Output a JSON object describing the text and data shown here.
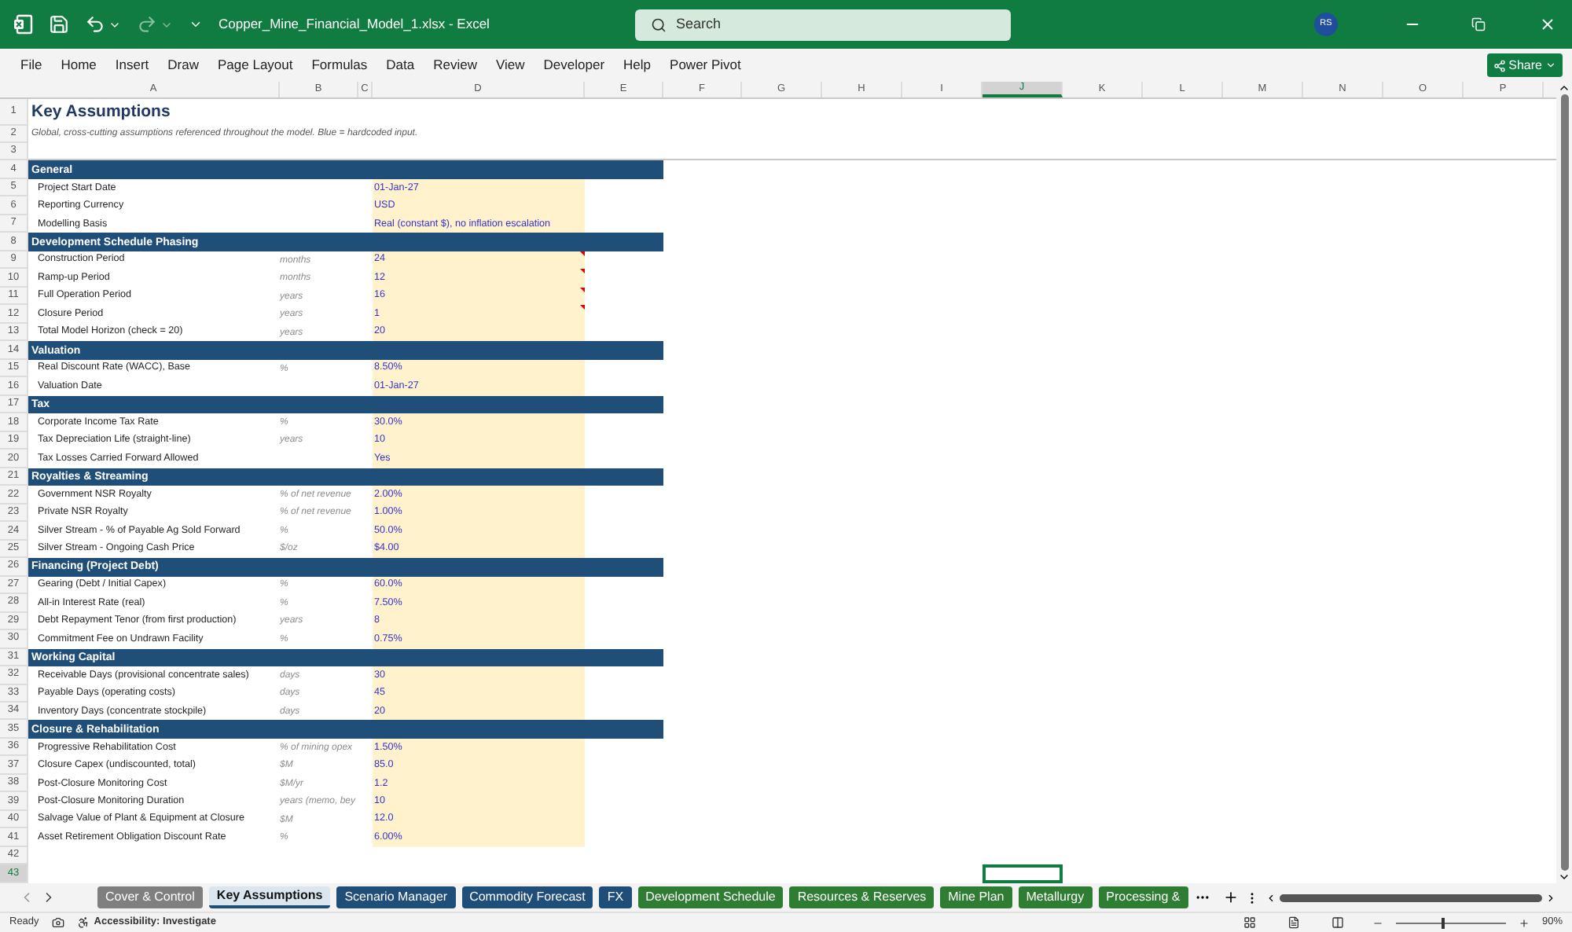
{
  "window": {
    "title": "Copper_Mine_Financial_Model_1.xlsx  -  Excel",
    "search_placeholder": "Search",
    "user_initials": "RS"
  },
  "menu": {
    "items": [
      "File",
      "Home",
      "Insert",
      "Draw",
      "Page Layout",
      "Formulas",
      "Data",
      "Review",
      "View",
      "Developer",
      "Help",
      "Power Pivot"
    ],
    "share": "Share"
  },
  "columns": [
    {
      "label": "A",
      "selected": false
    },
    {
      "label": "B",
      "selected": false
    },
    {
      "label": "C",
      "selected": false
    },
    {
      "label": "D",
      "selected": false
    },
    {
      "label": "E",
      "selected": false
    },
    {
      "label": "F",
      "selected": false
    },
    {
      "label": "G",
      "selected": false
    },
    {
      "label": "H",
      "selected": false
    },
    {
      "label": "I",
      "selected": false
    },
    {
      "label": "J",
      "selected": true
    },
    {
      "label": "K",
      "selected": false
    },
    {
      "label": "L",
      "selected": false
    },
    {
      "label": "M",
      "selected": false
    },
    {
      "label": "N",
      "selected": false
    },
    {
      "label": "O",
      "selected": false
    },
    {
      "label": "P",
      "selected": false
    }
  ],
  "rows": [
    {
      "number": "1",
      "kind": "title",
      "label": "Key Assumptions",
      "selected": false
    },
    {
      "number": "2",
      "kind": "note",
      "label": "Global, cross-cutting assumptions referenced throughout the model. Blue = hardcoded input.",
      "selected": false
    },
    {
      "number": "3",
      "kind": "blank",
      "selected": false
    },
    {
      "number": "4",
      "kind": "section",
      "label": "General",
      "selected": false
    },
    {
      "number": "5",
      "kind": "item",
      "label": "Project Start Date",
      "value": "01-Jan-27",
      "selected": false
    },
    {
      "number": "6",
      "kind": "item",
      "label": "Reporting Currency",
      "value": "USD",
      "selected": false
    },
    {
      "number": "7",
      "kind": "item",
      "label": "Modelling Basis",
      "value": "Real (constant $), no inflation escalation",
      "selected": false
    },
    {
      "number": "8",
      "kind": "section",
      "label": "Development Schedule Phasing",
      "selected": false
    },
    {
      "number": "9",
      "kind": "item",
      "label": "Construction Period",
      "unit": "months",
      "value": "24",
      "comment": true,
      "selected": false
    },
    {
      "number": "10",
      "kind": "item",
      "label": "Ramp-up Period",
      "unit": "months",
      "value": "12",
      "comment": true,
      "selected": false
    },
    {
      "number": "11",
      "kind": "item",
      "label": "Full Operation Period",
      "unit": "years",
      "value": "16",
      "comment": true,
      "selected": false
    },
    {
      "number": "12",
      "kind": "item",
      "label": "Closure Period",
      "unit": "years",
      "value": "1",
      "comment": true,
      "selected": false
    },
    {
      "number": "13",
      "kind": "item",
      "label": "Total Model Horizon (check = 20)",
      "unit": "years",
      "value": "20",
      "selected": false
    },
    {
      "number": "14",
      "kind": "section",
      "label": "Valuation",
      "selected": false
    },
    {
      "number": "15",
      "kind": "item",
      "label": "Real Discount Rate (WACC), Base",
      "unit": "%",
      "value": "8.50%",
      "selected": false
    },
    {
      "number": "16",
      "kind": "item",
      "label": "Valuation Date",
      "value": "01-Jan-27",
      "selected": false
    },
    {
      "number": "17",
      "kind": "section",
      "label": "Tax",
      "selected": false
    },
    {
      "number": "18",
      "kind": "item",
      "label": "Corporate Income Tax Rate",
      "unit": "%",
      "value": "30.0%",
      "selected": false
    },
    {
      "number": "19",
      "kind": "item",
      "label": "Tax Depreciation Life (straight-line)",
      "unit": "years",
      "value": "10",
      "selected": false
    },
    {
      "number": "20",
      "kind": "item",
      "label": "Tax Losses Carried Forward Allowed",
      "value": "Yes",
      "selected": false
    },
    {
      "number": "21",
      "kind": "section",
      "label": "Royalties & Streaming",
      "selected": false
    },
    {
      "number": "22",
      "kind": "item",
      "label": "Government NSR Royalty",
      "unit": "% of net revenue",
      "value": "2.00%",
      "selected": false
    },
    {
      "number": "23",
      "kind": "item",
      "label": "Private NSR Royalty",
      "unit": "% of net revenue",
      "value": "1.00%",
      "selected": false
    },
    {
      "number": "24",
      "kind": "item",
      "label": "Silver Stream - % of Payable Ag Sold Forward",
      "unit": "%",
      "value": "50.0%",
      "selected": false
    },
    {
      "number": "25",
      "kind": "item",
      "label": "Silver Stream - Ongoing Cash Price",
      "unit": "$/oz",
      "value": "$4.00",
      "selected": false
    },
    {
      "number": "26",
      "kind": "section",
      "label": "Financing (Project Debt)",
      "selected": false
    },
    {
      "number": "27",
      "kind": "item",
      "label": "Gearing (Debt / Initial Capex)",
      "unit": "%",
      "value": "60.0%",
      "selected": false
    },
    {
      "number": "28",
      "kind": "item",
      "label": "All-in Interest Rate (real)",
      "unit": "%",
      "value": "7.50%",
      "selected": false
    },
    {
      "number": "29",
      "kind": "item",
      "label": "Debt Repayment Tenor (from first production)",
      "unit": "years",
      "value": "8",
      "selected": false
    },
    {
      "number": "30",
      "kind": "item",
      "label": "Commitment Fee on Undrawn Facility",
      "unit": "%",
      "value": "0.75%",
      "selected": false
    },
    {
      "number": "31",
      "kind": "section",
      "label": "Working Capital",
      "selected": false
    },
    {
      "number": "32",
      "kind": "item",
      "label": "Receivable Days (provisional concentrate sales)",
      "unit": "days",
      "value": "30",
      "selected": false
    },
    {
      "number": "33",
      "kind": "item",
      "label": "Payable Days (operating costs)",
      "unit": "days",
      "value": "45",
      "selected": false
    },
    {
      "number": "34",
      "kind": "item",
      "label": "Inventory Days (concentrate stockpile)",
      "unit": "days",
      "value": "20",
      "selected": false
    },
    {
      "number": "35",
      "kind": "section",
      "label": "Closure & Rehabilitation",
      "selected": false
    },
    {
      "number": "36",
      "kind": "item",
      "label": "Progressive Rehabilitation Cost",
      "unit": "% of mining opex",
      "value": "1.50%",
      "selected": false
    },
    {
      "number": "37",
      "kind": "item",
      "label": "Closure Capex (undiscounted, total)",
      "unit": "$M",
      "value": "85.0",
      "selected": false
    },
    {
      "number": "38",
      "kind": "item",
      "label": "Post-Closure Monitoring Cost",
      "unit": "$M/yr",
      "value": "1.2",
      "selected": false
    },
    {
      "number": "39",
      "kind": "item",
      "label": "Post-Closure Monitoring Duration",
      "unit": "years (memo, bey",
      "value": "10",
      "selected": false
    },
    {
      "number": "40",
      "kind": "item",
      "label": "Salvage Value of Plant & Equipment at Closure",
      "unit": "$M",
      "value": "12.0",
      "selected": false
    },
    {
      "number": "41",
      "kind": "item",
      "label": "Asset Retirement Obligation Discount Rate",
      "unit": "%",
      "value": "6.00%",
      "selected": false
    },
    {
      "number": "42",
      "kind": "blank",
      "selected": false
    },
    {
      "number": "43",
      "kind": "blank",
      "selected": true
    }
  ],
  "sheet_tabs": [
    {
      "label": "Cover & Control",
      "selected": false,
      "color": "#7f7f7f"
    },
    {
      "label": "Key Assumptions",
      "selected": true
    },
    {
      "label": "Scenario Manager",
      "selected": false,
      "color": "#1f4e79"
    },
    {
      "label": "Commodity Forecast",
      "selected": false,
      "color": "#1f4e79"
    },
    {
      "label": "FX",
      "selected": false,
      "color": "#1f4e79"
    },
    {
      "label": "Development Schedule",
      "selected": false,
      "color": "#2e7d32"
    },
    {
      "label": "Resources & Reserves",
      "selected": false,
      "color": "#2e7d32"
    },
    {
      "label": "Mine Plan",
      "selected": false,
      "color": "#2e7d32"
    },
    {
      "label": "Metallurgy",
      "selected": false,
      "color": "#2e7d32"
    },
    {
      "label": "Processing &",
      "selected": false,
      "color": "#2e7d32"
    }
  ],
  "status_bar": {
    "status": "Ready",
    "accessibility": "Accessibility: Investigate",
    "zoom": "90%",
    "zoom_slider": {
      "level": 0.42
    }
  }
}
